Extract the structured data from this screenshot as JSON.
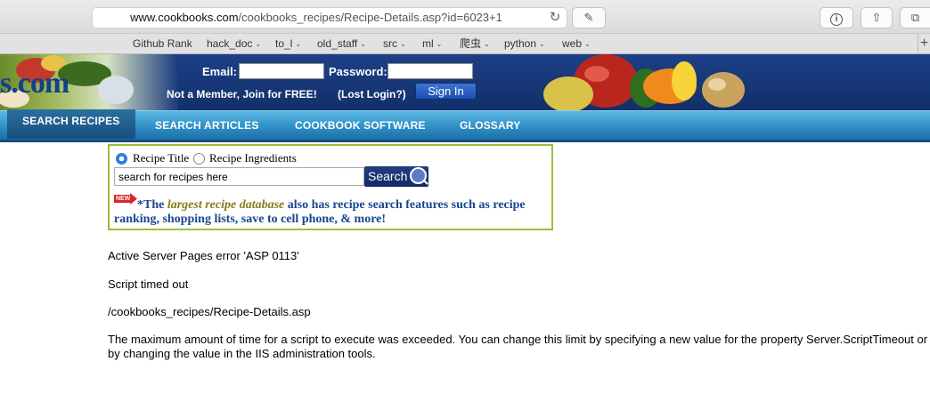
{
  "browser": {
    "url_domain": "www.cookbooks.com",
    "url_path": "/cookbooks_recipes/Recipe-Details.asp?id=6023+1",
    "bookmarks": [
      "Github Rank",
      "hack_doc",
      "to_l",
      "old_staff",
      "src",
      "ml",
      "爬虫",
      "python",
      "web"
    ]
  },
  "header": {
    "logo_text": "s.com",
    "email_label": "Email:",
    "password_label": "Password:",
    "join_text": "Not a Member, Join for FREE!",
    "lost_login_text": "(Lost Login?)",
    "signin_label": "Sign In"
  },
  "nav": {
    "items": [
      "SEARCH RECIPES",
      "SEARCH ARTICLES",
      "COOKBOOK SOFTWARE",
      "GLOSSARY"
    ]
  },
  "search": {
    "option_title": "Recipe Title",
    "option_ingredients": "Recipe Ingredients",
    "selected": "Recipe Title",
    "input_value": "search for recipes here",
    "button_label": "Search",
    "new_badge": "NEW",
    "promo_prefix": "*The ",
    "promo_highlight": "largest recipe database",
    "promo_rest": " also has recipe search features such as recipe ranking, shopping lists, save to cell phone, & more!"
  },
  "error": {
    "title": "Active Server Pages error 'ASP 0113'",
    "subtitle": "Script timed out",
    "path": "/cookbooks_recipes/Recipe-Details.asp",
    "message_line1": "The maximum amount of time for a script to execute was exceeded. You can change this limit by specifying a new value for the property Server.ScriptTimeout or",
    "message_line2": "by changing the value in the IIS administration tools."
  },
  "colors": {
    "header_blue": "#163675",
    "nav_blue": "#2f8fc6",
    "search_border": "#9bbf3a",
    "promo_text": "#17468e"
  }
}
